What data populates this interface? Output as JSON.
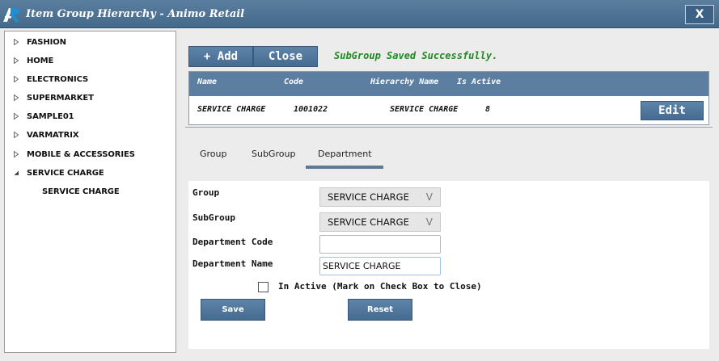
{
  "window": {
    "title": "Item Group Hierarchy - Animo Retail",
    "close_label": "X"
  },
  "tree": {
    "items": [
      {
        "label": "FASHION",
        "expanded": false
      },
      {
        "label": "HOME",
        "expanded": false
      },
      {
        "label": "ELECTRONICS",
        "expanded": false
      },
      {
        "label": "SUPERMARKET",
        "expanded": false
      },
      {
        "label": "SAMPLE01",
        "expanded": false
      },
      {
        "label": "VARMATRIX",
        "expanded": false
      },
      {
        "label": "MOBILE & ACCESSORIES",
        "expanded": false
      },
      {
        "label": "SERVICE CHARGE",
        "expanded": true,
        "children": [
          {
            "label": "SERVICE CHARGE"
          }
        ]
      }
    ]
  },
  "toolbar": {
    "add_label": "+ Add",
    "close_label": "Close",
    "status_message": "SubGroup Saved Successfully."
  },
  "grid": {
    "columns": [
      "Name",
      "Code",
      "Hierarchy Name",
      "Is Active"
    ],
    "rows": [
      {
        "name": "SERVICE CHARGE",
        "code": "1001022",
        "hierarchy": "SERVICE CHARGE",
        "active": "8",
        "action": "Edit"
      }
    ]
  },
  "tabs": [
    {
      "label": "Group",
      "active": false
    },
    {
      "label": "SubGroup",
      "active": false
    },
    {
      "label": "Department",
      "active": true
    }
  ],
  "form": {
    "group_label": "Group",
    "group_value": "SERVICE CHARGE",
    "subgroup_label": "SubGroup",
    "subgroup_value": "SERVICE CHARGE",
    "dept_code_label": "Department Code",
    "dept_code_value": "",
    "dept_name_label": "Department Name",
    "dept_name_value": "SERVICE CHARGE",
    "inactive_label": "In Active (Mark on Check Box to Close)",
    "inactive_checked": false,
    "save_label": "Save",
    "reset_label": "Reset",
    "dropdown_glyph": "V"
  },
  "colors": {
    "titlebar": "#4f7395",
    "button": "#4f7599",
    "status": "#1f8a1f",
    "grid_header": "#5c7ea0"
  }
}
